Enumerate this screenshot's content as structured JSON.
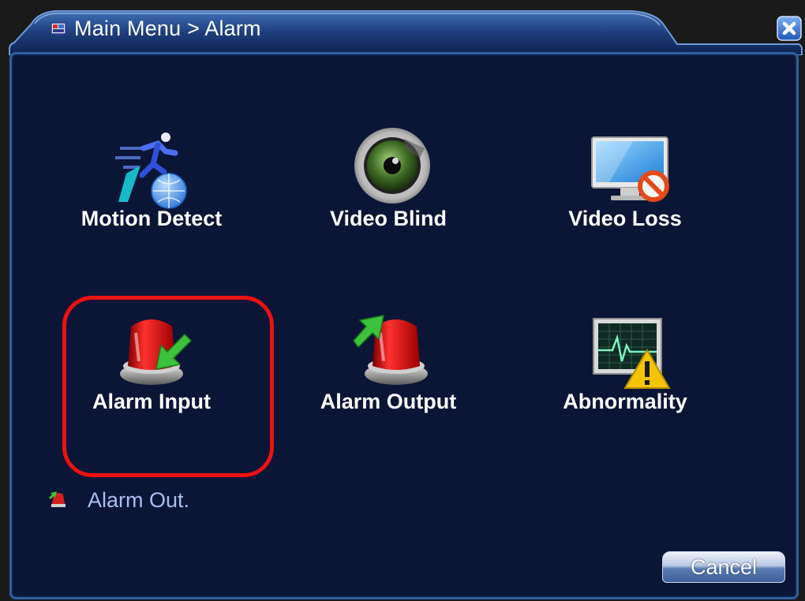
{
  "window": {
    "title": "Main Menu > Alarm",
    "close_icon": "close-icon"
  },
  "menu": {
    "items": [
      {
        "label": "Motion Detect",
        "icon": "motion-detect-icon"
      },
      {
        "label": "Video Blind",
        "icon": "video-blind-icon"
      },
      {
        "label": "Video Loss",
        "icon": "video-loss-icon"
      },
      {
        "label": "Alarm Input",
        "icon": "alarm-input-icon",
        "highlighted": true
      },
      {
        "label": "Alarm Output",
        "icon": "alarm-output-icon"
      },
      {
        "label": "Abnormality",
        "icon": "abnormality-icon"
      }
    ]
  },
  "status": {
    "text": "Alarm Out.",
    "icon": "alarm-out-icon"
  },
  "footer": {
    "cancel_label": "Cancel"
  },
  "colors": {
    "panel_bg": "#0b1535",
    "panel_border": "#2f5f9e",
    "highlight": "#ee1111",
    "status_text": "#a8bdf0"
  }
}
